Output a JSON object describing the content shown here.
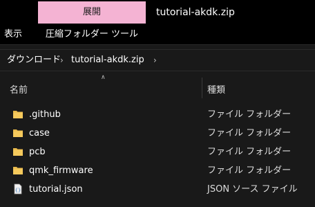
{
  "titlebar": {
    "context_tab_label": "展開",
    "window_title": "tutorial-akdk.zip"
  },
  "ribbon": {
    "view_label": "表示",
    "tools_label": "圧縮フォルダー ツール"
  },
  "address": {
    "crumbs": [
      "ダウンロード",
      "tutorial-akdk.zip"
    ]
  },
  "columns": {
    "name": "名前",
    "type": "種類"
  },
  "files": [
    {
      "name": ".github",
      "type": "ファイル フォルダー",
      "icon": "folder-icon"
    },
    {
      "name": "case",
      "type": "ファイル フォルダー",
      "icon": "folder-icon"
    },
    {
      "name": "pcb",
      "type": "ファイル フォルダー",
      "icon": "folder-icon"
    },
    {
      "name": "qmk_firmware",
      "type": "ファイル フォルダー",
      "icon": "folder-icon"
    },
    {
      "name": "tutorial.json",
      "type": "JSON ソース ファイル",
      "icon": "json-file-icon"
    }
  ],
  "colors": {
    "background": "#191919",
    "titlebar": "#000000",
    "context_tab": "#f4b3d3",
    "folder": "#e8b84a"
  }
}
